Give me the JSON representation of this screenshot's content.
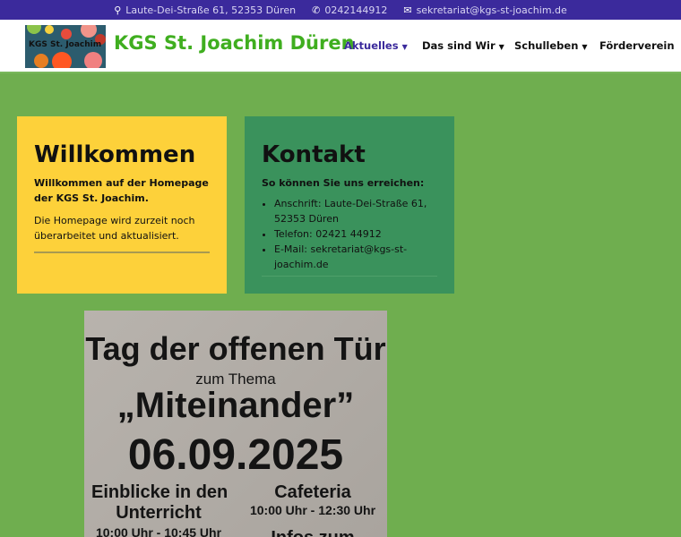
{
  "topbar": {
    "address": "Laute-Dei-Straße 61, 52353 Düren",
    "phone": "0242144912",
    "email": "sekretariat@kgs-st-joachim.de"
  },
  "header": {
    "logo_text": "KGS St. Joachim",
    "title": "KGS St. Joachim Düren",
    "nav": [
      {
        "label": "Aktuelles",
        "active": true
      },
      {
        "label": "Das sind Wir"
      },
      {
        "label": "Schulleben"
      },
      {
        "label": "Förderverein"
      }
    ]
  },
  "welcome": {
    "title": "Willkommen",
    "intro": "Willkommen auf der Homepage der KGS St. Joachim.",
    "text": "Die Homepage wird zurzeit noch überarbeitet und aktualisiert."
  },
  "contact": {
    "title": "Kontakt",
    "intro": "So können Sie uns erreichen:",
    "items": [
      "Anschrift: Laute-Dei-Straße 61, 52353 Düren",
      "Telefon: 02421 44912",
      "E-Mail: sekretariat@kgs-st-joachim.de"
    ]
  },
  "poster": {
    "line1": "Tag der offenen Tür",
    "line2": "zum Thema",
    "line3": "„Miteinander”",
    "date": "06.09.2025",
    "left_title1": "Einblicke in den",
    "left_title2": "Unterricht",
    "left_time": "10:00 Uhr - 10:45 Uhr",
    "right_title": "Cafeteria",
    "right_time": "10:00 Uhr - 12:30 Uhr",
    "right_more": "Infos zum"
  }
}
